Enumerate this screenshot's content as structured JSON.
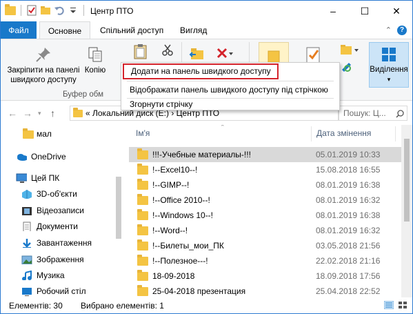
{
  "window": {
    "title": "Центр ПТО"
  },
  "tabs": {
    "file": "Файл",
    "home": "Основне",
    "share": "Спільний доступ",
    "view": "Вигляд"
  },
  "ribbon": {
    "pin_label": "Закріпити на панелі швидкого доступу",
    "copy_label": "Копію",
    "clipboard_group": "Буфер обм",
    "select_label": "Виділення"
  },
  "menu": {
    "items": [
      "Додати на панель швидкого доступу",
      "Відображати панель швидкого доступу під стрічкою",
      "Згорнути стрічку"
    ]
  },
  "address": {
    "path": "«  Локальний диск (E:)  ›  Центр ПТО",
    "search_placeholder": "Пошук: Ц..."
  },
  "nav": {
    "items": [
      {
        "label": "мал",
        "icon": "folder-icon"
      },
      {
        "label": "OneDrive",
        "icon": "onedrive-icon"
      },
      {
        "label": "Цей ПК",
        "icon": "this-pc-icon"
      },
      {
        "label": "3D-об'єкти",
        "icon": "3d-objects-icon"
      },
      {
        "label": "Відеозаписи",
        "icon": "videos-icon"
      },
      {
        "label": "Документи",
        "icon": "documents-icon"
      },
      {
        "label": "Завантаження",
        "icon": "downloads-icon"
      },
      {
        "label": "Зображення",
        "icon": "pictures-icon"
      },
      {
        "label": "Музика",
        "icon": "music-icon"
      },
      {
        "label": "Робочий стіл",
        "icon": "desktop-icon"
      }
    ]
  },
  "list": {
    "col_name": "Ім'я",
    "col_date": "Дата змінення",
    "rows": [
      {
        "name": "!!!-Учебные материалы-!!!",
        "date": "05.01.2019 10:33"
      },
      {
        "name": "!--Excel10--!",
        "date": "15.08.2018 16:55"
      },
      {
        "name": "!--GIMP--!",
        "date": "08.01.2019 16:38"
      },
      {
        "name": "!--Office 2010--!",
        "date": "08.01.2019 16:32"
      },
      {
        "name": "!--Windows 10--!",
        "date": "08.01.2019 16:38"
      },
      {
        "name": "!--Word--!",
        "date": "08.01.2019 16:32"
      },
      {
        "name": "!--Билеты_мои_ПК",
        "date": "03.05.2018 21:56"
      },
      {
        "name": "!--Полезное---!",
        "date": "22.02.2018 21:16"
      },
      {
        "name": "18-09-2018",
        "date": "18.09.2018 17:56"
      },
      {
        "name": "25-04-2018 презентация",
        "date": "25.04.2018 22:52"
      }
    ]
  },
  "status": {
    "count": "Елементів: 30",
    "selected": "Вибрано елементів: 1"
  },
  "colors": {
    "accent": "#1979ca",
    "highlight_border": "#d4232b",
    "folder": "#f4c443"
  }
}
